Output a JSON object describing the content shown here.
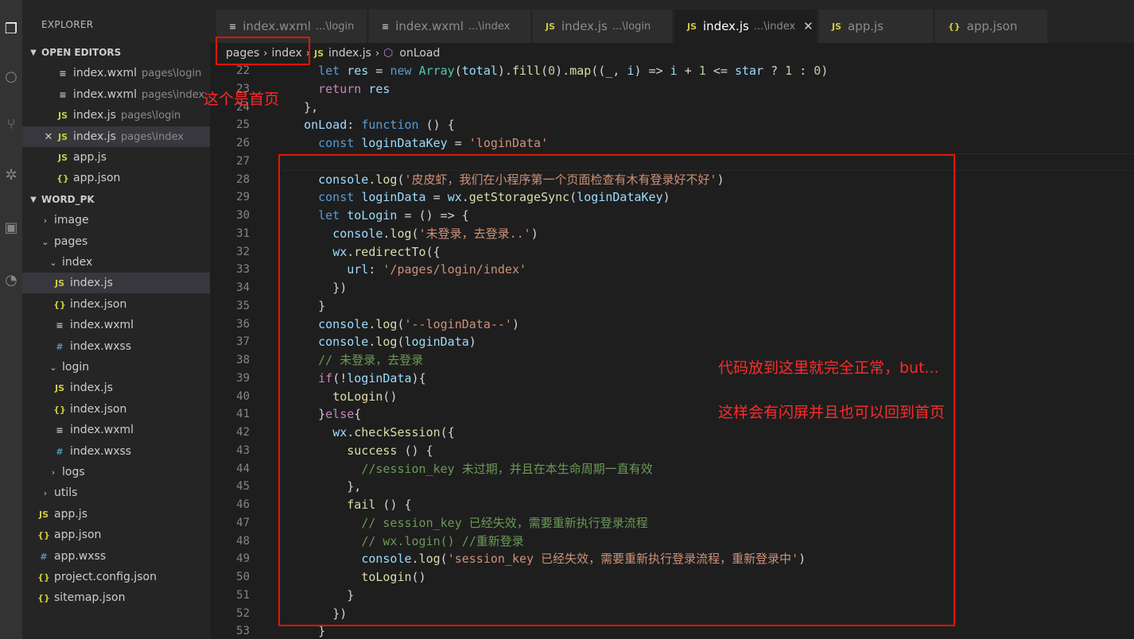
{
  "sidebar": {
    "title": "EXPLORER",
    "open_editors_header": "OPEN EDITORS",
    "project_header": "WORD_PK",
    "open_editors": [
      {
        "name": "index.wxml",
        "path": "pages\\login",
        "type": "wxml"
      },
      {
        "name": "index.wxml",
        "path": "pages\\index",
        "type": "wxml"
      },
      {
        "name": "index.js",
        "path": "pages\\login",
        "type": "js"
      },
      {
        "name": "index.js",
        "path": "pages\\index",
        "type": "js"
      },
      {
        "name": "app.js",
        "path": "",
        "type": "js"
      },
      {
        "name": "app.json",
        "path": "",
        "type": "json"
      }
    ],
    "tree": [
      {
        "name": "image",
        "kind": "folder"
      },
      {
        "name": "pages",
        "kind": "folder"
      },
      {
        "name": "index",
        "kind": "folder"
      },
      {
        "name": "index.js",
        "kind": "js"
      },
      {
        "name": "index.json",
        "kind": "json"
      },
      {
        "name": "index.wxml",
        "kind": "wxml"
      },
      {
        "name": "index.wxss",
        "kind": "wxss"
      },
      {
        "name": "login",
        "kind": "folder"
      },
      {
        "name": "index.js",
        "kind": "js"
      },
      {
        "name": "index.json",
        "kind": "json"
      },
      {
        "name": "index.wxml",
        "kind": "wxml"
      },
      {
        "name": "index.wxss",
        "kind": "wxss"
      },
      {
        "name": "logs",
        "kind": "folder"
      },
      {
        "name": "utils",
        "kind": "folder"
      },
      {
        "name": "app.js",
        "kind": "js"
      },
      {
        "name": "app.json",
        "kind": "json"
      },
      {
        "name": "app.wxss",
        "kind": "wxss"
      },
      {
        "name": "project.config.json",
        "kind": "json"
      },
      {
        "name": "sitemap.json",
        "kind": "json"
      }
    ]
  },
  "tabs": [
    {
      "name": "index.wxml",
      "path": "...\\login",
      "type": "wxml"
    },
    {
      "name": "index.wxml",
      "path": "...\\index",
      "type": "wxml"
    },
    {
      "name": "index.js",
      "path": "...\\login",
      "type": "js"
    },
    {
      "name": "index.js",
      "path": "...\\index",
      "type": "js"
    },
    {
      "name": "app.js",
      "path": "",
      "type": "js"
    },
    {
      "name": "app.json",
      "path": "",
      "type": "json"
    }
  ],
  "icons": {
    "js": "JS",
    "json": "{}",
    "wxml": "≡",
    "wxss": "#",
    "close": "✕",
    "chevron_down": "⌄",
    "chevron_right": "›",
    "method": "⬡"
  },
  "breadcrumb": {
    "parts": [
      "pages",
      "index",
      "index.js",
      "onLoad"
    ]
  },
  "annotations": {
    "home": "这个是首页",
    "note1": "代码放到这里就完全正常，but...",
    "note2": "这样会有闪屏并且也可以回到首页"
  },
  "code": [
    {
      "n": "22",
      "t": "    let res = new Array(total).fill(0).map((_, i) => i + 1 <= star ? 1 : 0)"
    },
    {
      "n": "23",
      "t": "    return res"
    },
    {
      "n": "24",
      "t": "  },"
    },
    {
      "n": "25",
      "t": "  onLoad: function () {"
    },
    {
      "n": "26",
      "t": "    const loginDataKey = 'loginData'"
    },
    {
      "n": "27",
      "t": ""
    },
    {
      "n": "28",
      "t": "    console.log('皮皮虾，我们在小程序第一个页面检查有木有登录好不好')"
    },
    {
      "n": "29",
      "t": "    const loginData = wx.getStorageSync(loginDataKey)"
    },
    {
      "n": "30",
      "t": "    let toLogin = () => {"
    },
    {
      "n": "31",
      "t": "      console.log('未登录，去登录..')"
    },
    {
      "n": "32",
      "t": "      wx.redirectTo({"
    },
    {
      "n": "33",
      "t": "        url: '/pages/login/index'"
    },
    {
      "n": "34",
      "t": "      })"
    },
    {
      "n": "35",
      "t": "    }"
    },
    {
      "n": "36",
      "t": "    console.log('--loginData--')"
    },
    {
      "n": "37",
      "t": "    console.log(loginData)"
    },
    {
      "n": "38",
      "t": "    // 未登录，去登录"
    },
    {
      "n": "39",
      "t": "    if(!loginData){"
    },
    {
      "n": "40",
      "t": "      toLogin()"
    },
    {
      "n": "41",
      "t": "    }else{"
    },
    {
      "n": "42",
      "t": "      wx.checkSession({"
    },
    {
      "n": "43",
      "t": "        success () {"
    },
    {
      "n": "44",
      "t": "          //session_key 未过期，并且在本生命周期一直有效"
    },
    {
      "n": "45",
      "t": "        },"
    },
    {
      "n": "46",
      "t": "        fail () {"
    },
    {
      "n": "47",
      "t": "          // session_key 已经失效，需要重新执行登录流程"
    },
    {
      "n": "48",
      "t": "          // wx.login() //重新登录"
    },
    {
      "n": "49",
      "t": "          console.log('session_key 已经失效，需要重新执行登录流程，重新登录中')"
    },
    {
      "n": "50",
      "t": "          toLogin()"
    },
    {
      "n": "51",
      "t": "        }"
    },
    {
      "n": "52",
      "t": "      })"
    },
    {
      "n": "53",
      "t": "    }"
    }
  ]
}
